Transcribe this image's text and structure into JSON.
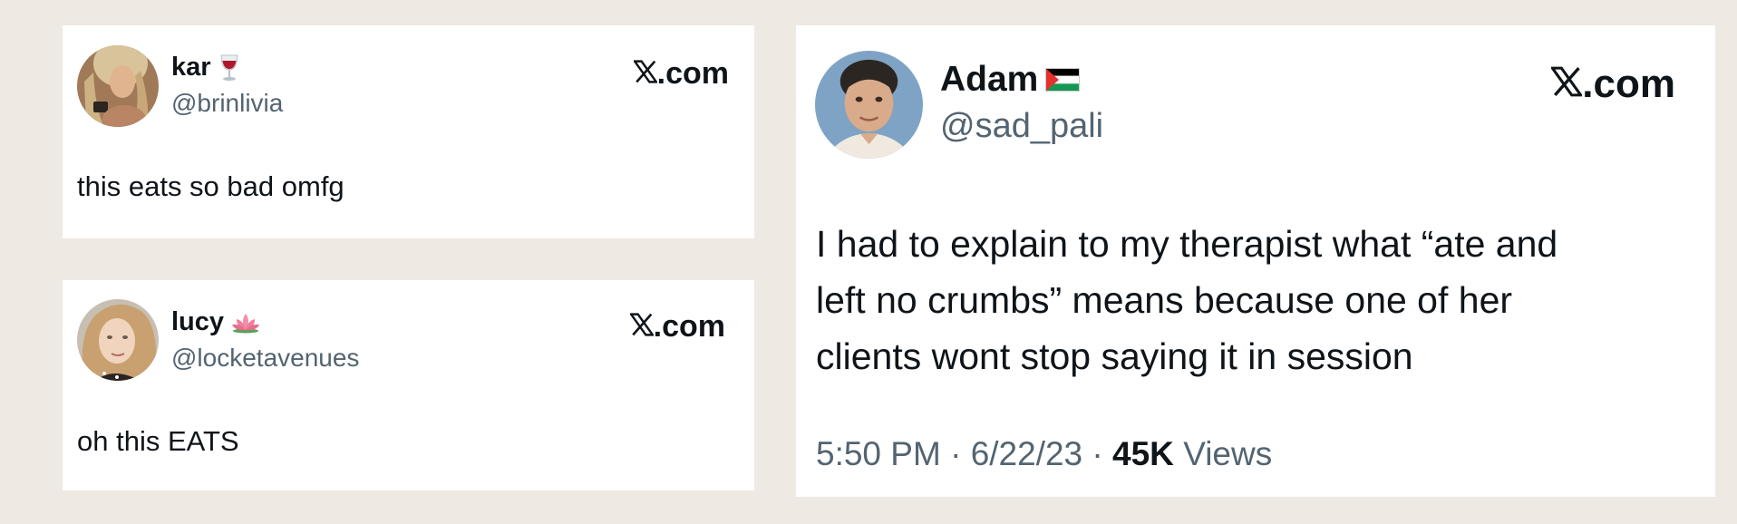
{
  "tweets": [
    {
      "display_name": "kar",
      "name_emoji": "wine-glass-icon",
      "handle": "@brinlivia",
      "brand": ".com",
      "text": "this eats so bad omfg"
    },
    {
      "display_name": "lucy",
      "name_emoji": "lotus-icon",
      "handle": "@locketavenues",
      "brand": ".com",
      "text": "oh this EATS"
    },
    {
      "display_name": "Adam",
      "name_emoji": "palestine-flag-icon",
      "handle": "@sad_pali",
      "brand": ".com",
      "text_lines": [
        "I had to explain to my therapist what “ate and",
        "left no crumbs” means because one of her",
        "clients wont stop saying it in session"
      ],
      "time": "5:50 PM",
      "date": "6/22/23",
      "views_count": "45K",
      "views_label": "Views"
    }
  ],
  "colors": {
    "background": "#eee9e2",
    "card": "#ffffff",
    "text": "#0f1419",
    "secondary": "#536471"
  }
}
